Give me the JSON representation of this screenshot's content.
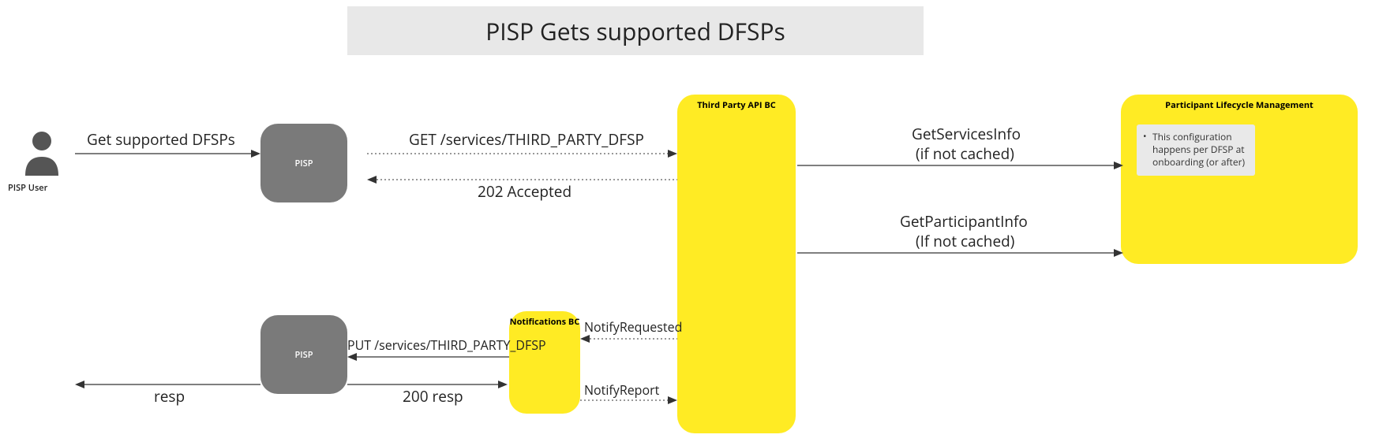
{
  "title": "PISP Gets supported DFSPs",
  "actor": {
    "label": "PISP User"
  },
  "nodes": {
    "pisp1": "PISP",
    "pisp2": "PISP",
    "third_party": "Third Party API BC",
    "notifications": "Notifications BC",
    "plm": "Participant Lifecycle Management"
  },
  "note": "This configuration happens per DFSP at onboarding (or after)",
  "messages": {
    "get_supported": "Get supported DFSPs",
    "get_services": "GET /services/THIRD_PARTY_DFSP",
    "accepted": "202 Accepted",
    "get_services_info": "GetServicesInfo",
    "if_not_cached1": "(if not cached)",
    "get_participant": "GetParticipantInfo",
    "if_not_cached2": "(If not cached)",
    "notify_requested": "NotifyRequested",
    "put_services": "PUT /services/THIRD_PARTY_DFSP",
    "resp200": "200 resp",
    "notify_report": "NotifyReport",
    "resp": "resp"
  },
  "colors": {
    "yellow": "#ffeb24",
    "gray_node": "#7a7a7a",
    "title_bg": "#e8e8e8",
    "actor": "#555555"
  }
}
